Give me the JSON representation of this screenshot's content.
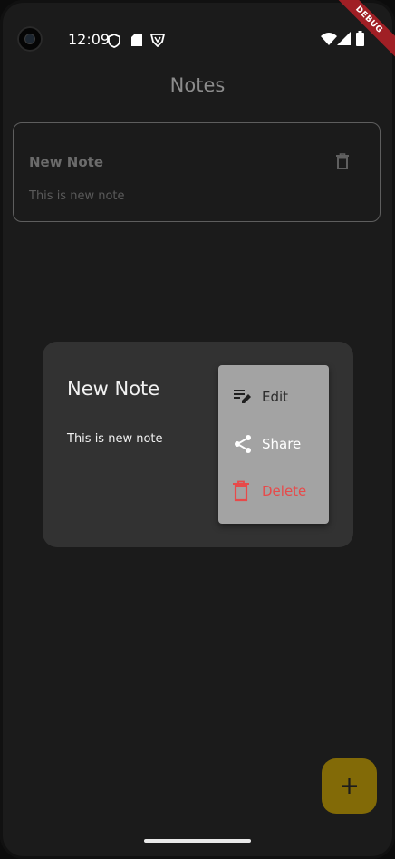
{
  "status_bar": {
    "time": "12:09"
  },
  "debug_banner": "DEBUG",
  "app_bar": {
    "title": "Notes"
  },
  "notes": [
    {
      "title": "New Note",
      "body": "This is new note"
    }
  ],
  "dialog": {
    "title": "New Note",
    "body": "This is new note"
  },
  "menu": {
    "edit_label": "Edit",
    "share_label": "Share",
    "delete_label": "Delete"
  },
  "fab": {
    "icon": "plus-icon"
  },
  "colors": {
    "background": "#1b1b1b",
    "dialog": "#323232",
    "menu": "#a3a3a3",
    "delete_red": "#e74a4a",
    "fab": "#826a07",
    "debug_banner": "#a01f25"
  }
}
